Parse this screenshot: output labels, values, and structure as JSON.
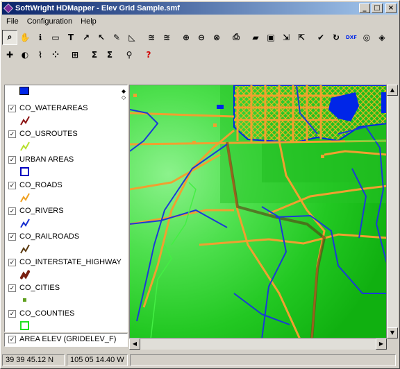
{
  "window": {
    "title": "SoftWright HDMapper - Elev Grid Sample.smf",
    "min": "_",
    "max": "□",
    "close": "×"
  },
  "menu": [
    {
      "label": "File"
    },
    {
      "label": "Configuration"
    },
    {
      "label": "Help"
    }
  ],
  "toolbar1": [
    {
      "name": "zoom-tool-icon",
      "glyph": "⌕"
    },
    {
      "name": "pan-hand-icon",
      "glyph": "✋"
    },
    {
      "name": "info-icon",
      "glyph": "ℹ"
    },
    {
      "name": "label-icon",
      "glyph": "▭"
    },
    {
      "name": "text-tool-icon",
      "glyph": "T"
    },
    {
      "name": "measure-line-icon",
      "glyph": "↗"
    },
    {
      "name": "select-arrow-icon",
      "glyph": "↖"
    },
    {
      "name": "pick-point-icon",
      "glyph": "✎"
    },
    {
      "name": "profile-icon",
      "glyph": "◺"
    },
    {
      "name": "layers-icon",
      "glyph": "≋"
    },
    {
      "name": "layers-edit-icon",
      "glyph": "≋"
    },
    {
      "name": "zoom-in-icon",
      "glyph": "⊕"
    },
    {
      "name": "zoom-out-icon",
      "glyph": "⊖"
    },
    {
      "name": "zoom-cancel-icon",
      "glyph": "⊗"
    },
    {
      "name": "print-icon",
      "glyph": "⎙"
    },
    {
      "name": "open-folder-icon",
      "glyph": "▰"
    },
    {
      "name": "save-icon",
      "glyph": "▣"
    },
    {
      "name": "import-icon",
      "glyph": "⇲"
    },
    {
      "name": "export-icon",
      "glyph": "⇱"
    },
    {
      "name": "check-layer-icon",
      "glyph": "✔"
    },
    {
      "name": "refresh-layer-icon",
      "glyph": "↻"
    },
    {
      "name": "dxf-icon",
      "glyph": "DXF"
    },
    {
      "name": "target-icon",
      "glyph": "◎"
    },
    {
      "name": "color-map-icon",
      "glyph": "◈"
    }
  ],
  "toolbar2": [
    {
      "name": "add-site-icon",
      "glyph": "✚"
    },
    {
      "name": "coverage-icon",
      "glyph": "◐"
    },
    {
      "name": "path-icon",
      "glyph": "⌇"
    },
    {
      "name": "scatter-points-icon",
      "glyph": "⁘"
    },
    {
      "name": "window-icon",
      "glyph": "⊞"
    },
    {
      "name": "sum-icon",
      "glyph": "Σ"
    },
    {
      "name": "sum-edit-icon",
      "glyph": "Σ"
    },
    {
      "name": "wrench-icon",
      "glyph": "⚲"
    },
    {
      "name": "help-icon",
      "glyph": "?"
    }
  ],
  "legend": {
    "layers": [
      {
        "label": "CO_WATERAREAS",
        "checked": true,
        "color": "#8a1010",
        "symbol": "line"
      },
      {
        "label": "CO_USROUTES",
        "checked": true,
        "color": "#b8e030",
        "symbol": "line"
      },
      {
        "label": "URBAN AREAS",
        "checked": true,
        "color": "#0000c0",
        "symbol": "box"
      },
      {
        "label": "CO_ROADS",
        "checked": true,
        "color": "#f0a020",
        "symbol": "line"
      },
      {
        "label": "CO_RIVERS",
        "checked": true,
        "color": "#1830d0",
        "symbol": "line"
      },
      {
        "label": "CO_RAILROADS",
        "checked": true,
        "color": "#5a3a10",
        "symbol": "line"
      },
      {
        "label": "CO_INTERSTATE_HIGHWAY",
        "checked": true,
        "color": "#7a2010",
        "symbol": "thick"
      },
      {
        "label": "CO_CITIES",
        "checked": true,
        "color": "#60a020",
        "symbol": "dot"
      },
      {
        "label": "CO_COUNTIES",
        "checked": true,
        "color": "#20e020",
        "symbol": "box"
      }
    ],
    "bottom_layer": {
      "label": "AREA ELEV (GRIDELEV_F)",
      "checked": true
    }
  },
  "status": {
    "lat": "39 39 45.12 N",
    "lon": "105 05 14.40 W"
  },
  "colors": {
    "water": "#0026e8",
    "road": "#f0a030",
    "river": "#1a3ad8",
    "urban": "#e2b820",
    "county": "#44ee44",
    "terrain_light": "#7ef07e",
    "terrain_dark": "#10b010"
  }
}
